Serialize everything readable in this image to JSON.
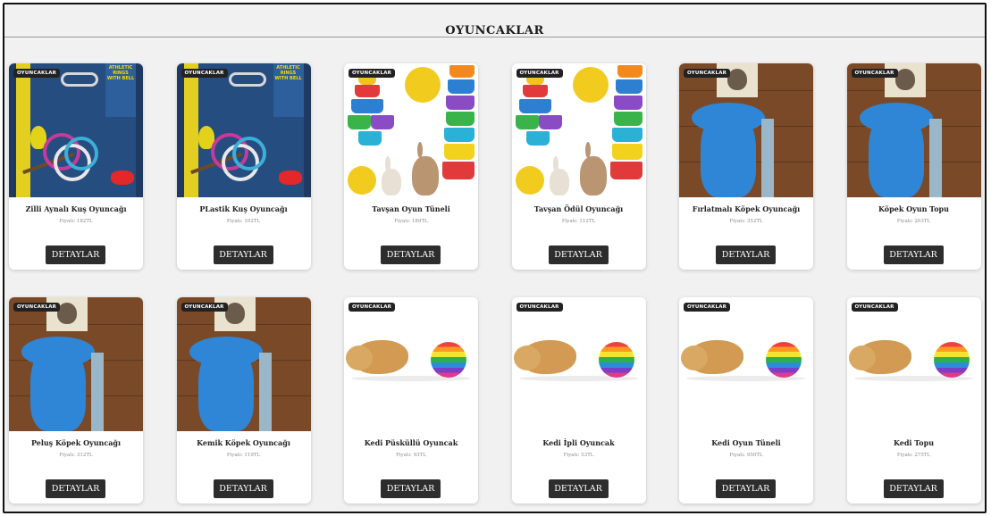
{
  "page": {
    "title": "OYUNCAKLAR"
  },
  "products": [
    {
      "badge": "OYUNCAKLAR",
      "name": "Zilli Aynalı Kuş Oyuncağı",
      "price": "Fiyatı: 182TL",
      "button": "DETAYLAR",
      "image": "bird-toy"
    },
    {
      "badge": "OYUNCAKLAR",
      "name": "PLastik Kuş Oyuncağı",
      "price": "Fiyatı: 102TL",
      "button": "DETAYLAR",
      "image": "bird-toy"
    },
    {
      "badge": "OYUNCAKLAR",
      "name": "Tavşan Oyun Tüneli",
      "price": "Fiyatı: 189TL",
      "button": "DETAYLAR",
      "image": "rabbit-toy"
    },
    {
      "badge": "OYUNCAKLAR",
      "name": "Tavşan Ödül Oyuncağı",
      "price": "Fiyatı: 112TL",
      "button": "DETAYLAR",
      "image": "rabbit-toy"
    },
    {
      "badge": "OYUNCAKLAR",
      "name": "Fırlatmalı Köpek Oyuncağı",
      "price": "Fiyatı: 352TL",
      "button": "DETAYLAR",
      "image": "dog-bone"
    },
    {
      "badge": "OYUNCAKLAR",
      "name": "Köpek Oyun Topu",
      "price": "Fiyatı: 203TL",
      "button": "DETAYLAR",
      "image": "dog-bone"
    },
    {
      "badge": "OYUNCAKLAR",
      "name": "Peluş Köpek Oyuncağı",
      "price": "Fiyatı: 312TL",
      "button": "DETAYLAR",
      "image": "dog-bone"
    },
    {
      "badge": "OYUNCAKLAR",
      "name": "Kemik Köpek Oyuncağı",
      "price": "Fiyatı: 119TL",
      "button": "DETAYLAR",
      "image": "dog-bone"
    },
    {
      "badge": "OYUNCAKLAR",
      "name": "Kedi Püsküllü Oyuncak",
      "price": "Fiyatı: 93TL",
      "button": "DETAYLAR",
      "image": "cat-ball"
    },
    {
      "badge": "OYUNCAKLAR",
      "name": "Kedi İpli Oyuncak",
      "price": "Fiyatı: 53TL",
      "button": "DETAYLAR",
      "image": "cat-ball"
    },
    {
      "badge": "OYUNCAKLAR",
      "name": "Kedi Oyun Tüneli",
      "price": "Fiyatı: 950TL",
      "button": "DETAYLAR",
      "image": "cat-ball"
    },
    {
      "badge": "OYUNCAKLAR",
      "name": "Kedi Topu",
      "price": "Fiyatı: 275TL",
      "button": "DETAYLAR",
      "image": "cat-ball"
    }
  ]
}
